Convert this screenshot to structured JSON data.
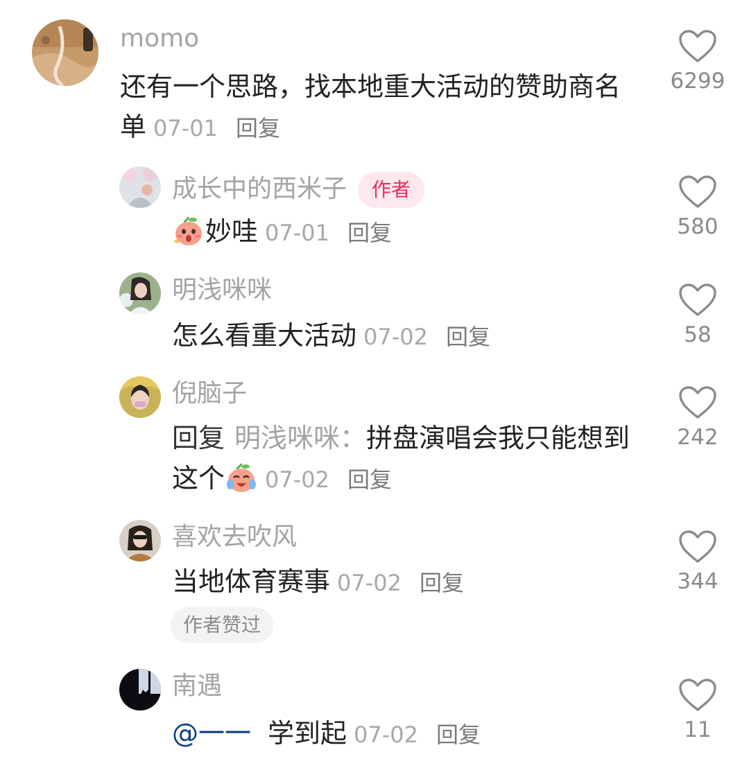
{
  "comments": [
    {
      "username": "momo",
      "text": "还有一个思路，找本地重大活动的赞助商名单",
      "date": "07-01",
      "reply_label": "回复",
      "likes": "6299",
      "avatar_icon": "beach-photo-avatar"
    },
    {
      "username": "成长中的西米子",
      "badge": "作者",
      "emoji": "surprised-peach-emoji",
      "text": "妙哇",
      "date": "07-01",
      "reply_label": "回复",
      "likes": "580"
    },
    {
      "username": "明浅咪咪",
      "text": "怎么看重大活动",
      "date": "07-02",
      "reply_label": "回复",
      "likes": "58"
    },
    {
      "username": "倪脑子",
      "reply_prefix": "回复",
      "reply_target": "明浅咪咪：",
      "text": "拼盘演唱会我只能想到这个",
      "emoji": "crying-laughing-peach-emoji",
      "date": "07-02",
      "reply_label": "回复",
      "likes": "242"
    },
    {
      "username": "喜欢去吹风",
      "text": "当地体育赛事",
      "date": "07-02",
      "reply_label": "回复",
      "likes": "344",
      "chip": "作者赞过"
    },
    {
      "username": "南遇",
      "mention": "@一一",
      "text": "学到起",
      "date": "07-02",
      "reply_label": "回复",
      "likes": "11"
    }
  ],
  "colors": {
    "username": "#a3a3a8",
    "badge_bg": "#fde8ee",
    "badge_text": "#ee2a5c",
    "mention": "#0f3d86",
    "like_icon": "#8a8a8e"
  },
  "icons": {
    "like": "heart-outline-icon"
  }
}
